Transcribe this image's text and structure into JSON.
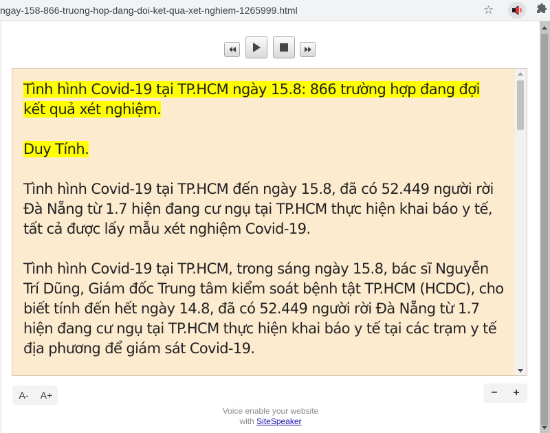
{
  "browser": {
    "url": "ngay-158-866-truong-hop-dang-doi-ket-qua-xet-nghiem-1265999.html"
  },
  "player": {
    "rewind": "rewind",
    "play": "play",
    "stop": "stop",
    "forward": "forward"
  },
  "article": {
    "title": "Tình hình Covid-19 tại TP.HCM ngày 15.8: 866 trường hợp đang đợi kết quả xét nghiệm.",
    "author": "Duy Tính.",
    "para1": "Tình hình Covid-19 tại TP.HCM đến ngày 15.8, đã có 52.449 người rời Đà Nẵng từ 1.7 hiện đang cư ngụ tại TP.HCM thực hiện khai báo y tế, tất cả được lấy mẫu xét nghiệm Covid-19.",
    "para2": "Tình hình Covid-19 tại TP.HCM, trong sáng ngày 15.8, bác sĩ Nguyễn Trí Dũng, Giám đốc Trung tâm kiểm soát bệnh tật TP.HCM (HCDC), cho biết tính đến hết ngày 14.8, đã có 52.449 người rời Đà Nẵng từ 1.7 hiện đang cư ngụ tại TP.HCM thực hiện khai báo y tế tại các trạm y tế địa phương để giám sát Covid-19."
  },
  "font_controls": {
    "decrease": "A-",
    "increase": "A+"
  },
  "zoom_controls": {
    "minus": "−",
    "plus": "+"
  },
  "footer": {
    "line1": "Voice enable your website",
    "with": "with",
    "link": "SiteSpeaker"
  },
  "colors": {
    "highlight": "#ffff00",
    "reader_bg": "#fdebd0"
  }
}
